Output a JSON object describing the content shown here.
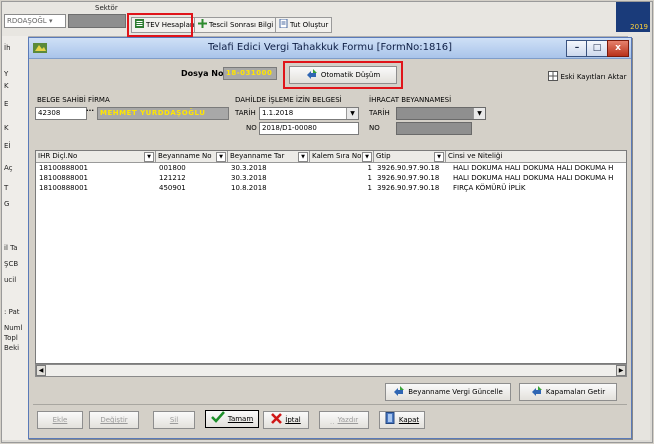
{
  "background_app": {
    "firm_combo_value": "RDOAŞOĞL",
    "sektor_label": "Sektör",
    "toolbar": {
      "tev_hesaplama": "TEV Hesaplama",
      "tescil_sonrasi": "Tescil Sonrası Bilgi Girişi",
      "tut_olustur": "Tut Oluştur"
    },
    "year_badge": "2019",
    "left_labels": [
      "İh",
      "Y",
      "K",
      "E",
      "K",
      "Eİ",
      "Aç",
      "T",
      "G",
      "il Ta",
      "ŞCB",
      "ucil",
      ": Pat",
      "Numl",
      "Topl",
      "Beki"
    ]
  },
  "dialog": {
    "title": "Telafi Edici Vergi Tahakkuk Formu [FormNo:1816]",
    "controls": {
      "minimize": "–",
      "maximize": "□",
      "close": "x"
    },
    "dosya_no_label": "Dosya No",
    "dosya_no_value": "18-031000",
    "otomatik_dusum_label": "Otomatik Düşüm",
    "eski_kayitlari_label": "Eski Kayıtları Aktar",
    "belge_sahibi_label": "BELGE SAHİBİ FİRMA",
    "firma_code": "42308",
    "firma_name": "MEHMET YURDDAŞOĞLU",
    "dis_label": "DAHİLDE İŞLEME İZİN BELGESİ",
    "tarih_label": "TARİH",
    "tarih_value": "1.1.2018",
    "no_label": "NO",
    "no_value": "2018/D1-00080",
    "ihracat_label": "İHRACAT BEYANNAMESİ",
    "ihr_tarih_label": "TARİH",
    "ihr_no_label": "NO",
    "grid": {
      "columns": [
        "IHR Diçl.No",
        "Beyanname No",
        "Beyanname Tar",
        "Kalem Sıra No",
        "Gtip",
        "Cinsi ve Niteliği"
      ],
      "rows": [
        [
          "18100888001",
          "001800",
          "30.3.2018",
          "1",
          "3926.90.97.90.18",
          "HALI DOKUMA HALI DOKUMA HALI DOKUMA H"
        ],
        [
          "18100888001",
          "121212",
          "30.3.2018",
          "1",
          "3926.90.97.90.18",
          "HALI DOKUMA HALI DOKUMA HALI DOKUMA H"
        ],
        [
          "18100888001",
          "450901",
          "10.8.2018",
          "1",
          "3926.90.97.90.18",
          "FIRÇA KÖMÜRÜ İPLİK"
        ]
      ]
    },
    "beyanname_vergi_label": "Beyanname Vergi Güncelle",
    "kapamalari_label": "Kapamaları Getir",
    "bottom": {
      "ekle": "Ekle",
      "degistir": "Değiştir",
      "sil": "Sil",
      "tamam": "Tamam",
      "iptal": "İptal",
      "yazdir": "Yazdır",
      "kapat": "Kapat"
    }
  },
  "colors": {
    "highlight": "#e0141a",
    "title_gradient_top": "#cfe0f6",
    "yellow_text": "#ffe600"
  }
}
